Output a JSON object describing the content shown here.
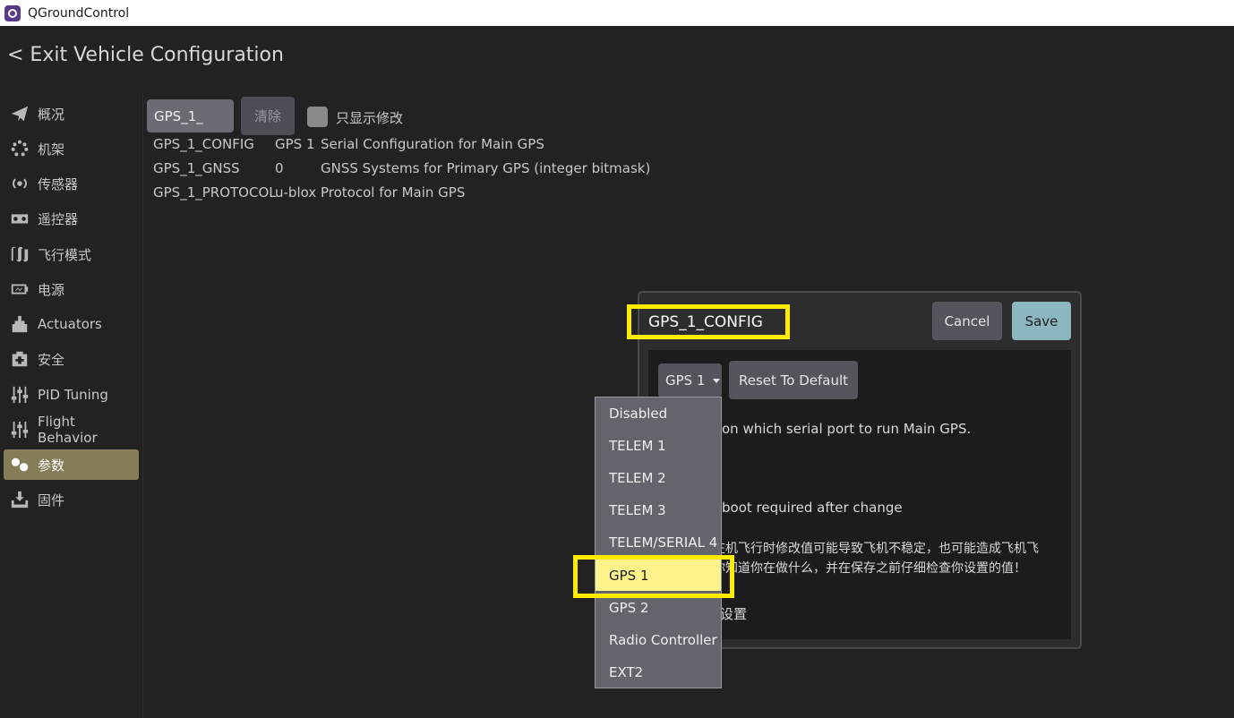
{
  "window": {
    "title": "QGroundControl"
  },
  "header": {
    "exit_label": "< Exit Vehicle Configuration"
  },
  "sidebar": {
    "items": [
      {
        "label": "概况",
        "icon": "paper-plane-icon"
      },
      {
        "label": "机架",
        "icon": "airframe-icon"
      },
      {
        "label": "传感器",
        "icon": "sensors-icon"
      },
      {
        "label": "遥控器",
        "icon": "radio-icon"
      },
      {
        "label": "飞行模式",
        "icon": "flight-modes-icon"
      },
      {
        "label": "电源",
        "icon": "power-icon"
      },
      {
        "label": "Actuators",
        "icon": "actuators-icon"
      },
      {
        "label": "安全",
        "icon": "safety-icon"
      },
      {
        "label": "PID Tuning",
        "icon": "tuning-icon"
      },
      {
        "label": "Flight Behavior",
        "icon": "tuning-icon"
      },
      {
        "label": "参数",
        "icon": "parameters-icon",
        "active": true
      },
      {
        "label": "固件",
        "icon": "firmware-icon"
      }
    ]
  },
  "search": {
    "value": "GPS_1_",
    "clear_label": "清除",
    "only_modified_label": "只显示修改"
  },
  "params": [
    {
      "name": "GPS_1_CONFIG",
      "value": "GPS 1",
      "desc": "Serial Configuration for Main GPS"
    },
    {
      "name": "GPS_1_GNSS",
      "value": "0",
      "desc": "GNSS Systems for Primary GPS (integer bitmask)"
    },
    {
      "name": "GPS_1_PROTOCOL",
      "value": "u-blox",
      "desc": "Protocol for Main GPS"
    }
  ],
  "dialog": {
    "title": "GPS_1_CONFIG",
    "cancel_label": "Cancel",
    "save_label": "Save",
    "selected_value": "GPS 1",
    "reset_label": "Reset To Default",
    "desc_fragment": "on which serial port to run Main GPS.",
    "reboot_fragment": "boot required after change",
    "warn_line1": "在机飞行时修改值可能导致飞机不稳定，也可能造成飞机飞",
    "warn_line2": "你知道你在做什么，并在保存之前仔细检查你设置的值！",
    "advanced_fragment": "设置"
  },
  "dropdown": {
    "options": [
      "Disabled",
      "TELEM 1",
      "TELEM 2",
      "TELEM 3",
      "TELEM/SERIAL 4",
      "GPS 1",
      "GPS 2",
      "Radio Controller",
      "EXT2"
    ],
    "selected": "GPS 1"
  }
}
